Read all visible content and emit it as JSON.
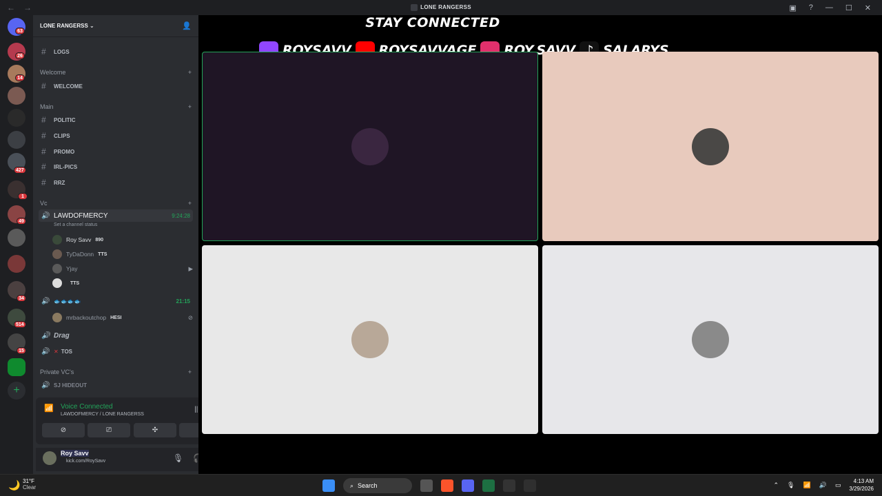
{
  "window": {
    "title": "LONE RANGERSS"
  },
  "server": {
    "name": "LONE RANGERSS"
  },
  "guild_badges": [
    "63",
    "26",
    "14",
    "427",
    "1",
    "49",
    "34",
    "514",
    "15"
  ],
  "channels": {
    "logs": "LOGS",
    "cat_welcome": "Welcome",
    "welcome": "WELCOME",
    "cat_main": "Main",
    "politic": "POLITIC",
    "clips": "CLIPS",
    "promo": "PROMO",
    "irl_pics": "IRL-PICS",
    "rrz": "RRZ",
    "cat_vc": "Vc",
    "vc1": {
      "name": "LAWDOFMERCY",
      "timer": "9:24:28",
      "status": "Set a channel status"
    },
    "vc1_users": [
      {
        "name": "Roy Savv",
        "tag": "890"
      },
      {
        "name": "TyDaDonn",
        "tag": "TTS"
      },
      {
        "name": "Yjay",
        "tag": ""
      },
      {
        "name": "",
        "tag": "TTS"
      }
    ],
    "vc2": {
      "name": "🐟🐟🐟🐟",
      "timer": "21:15"
    },
    "vc2_users": [
      {
        "name": "mrbackoutchop",
        "tag": "HESI"
      }
    ],
    "drag": "Drag",
    "tos": "TOS",
    "cat_private": "Private VC's",
    "sj_hideout": "SJ HIDEOUT"
  },
  "voice_panel": {
    "status": "Voice Connected",
    "location": "LAWDOFMERCY / LONE RANGERSS"
  },
  "user_panel": {
    "name": "Roy Savv",
    "status": "kick.com/RoySavv"
  },
  "stage": {
    "banner_title": "STAY CONNECTED",
    "socials": [
      {
        "icon": "twitch-icon",
        "label": "ROYSAVV",
        "color": "#9146ff"
      },
      {
        "icon": "youtube-icon",
        "label": "ROYSAVVAGE",
        "color": "#ff0000"
      },
      {
        "icon": "instagram-icon",
        "label": "ROY.SAVV",
        "color": "#e1306c"
      },
      {
        "icon": "tiktok-icon",
        "label": "SALARYS",
        "color": "#000000"
      }
    ],
    "tiles": [
      {
        "bg": "#1f1525",
        "speaking": true
      },
      {
        "bg": "#e8cabd",
        "speaking": false
      },
      {
        "bg": "#e8e8e8",
        "speaking": false
      },
      {
        "bg": "#e7e7ea",
        "speaking": false
      }
    ]
  },
  "taskbar": {
    "temp": "31°F",
    "weather": "Clear",
    "search": "Search",
    "time": "4:13 AM",
    "date": "3/29/2026"
  }
}
